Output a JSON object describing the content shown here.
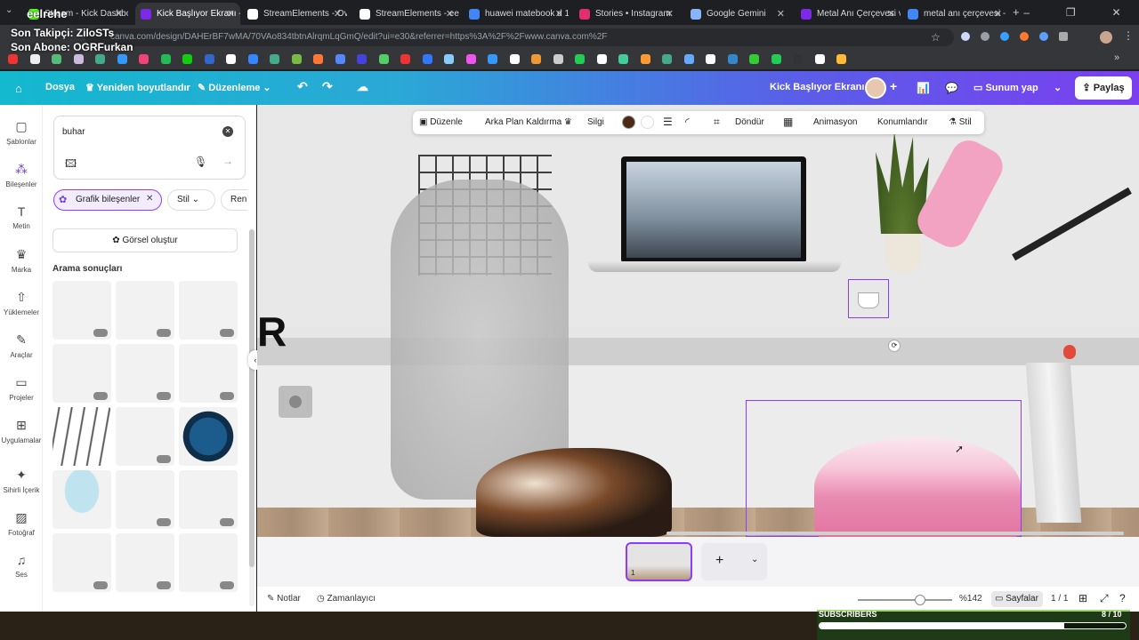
{
  "overlay": {
    "title": "eelrehe",
    "follower": "Son Takipçi: ZiloSTs",
    "subscriber": "Son Abone: OGRFurkan"
  },
  "tabs": [
    {
      "label": "Stream - Kick Dashbo",
      "color": "#53fc18"
    },
    {
      "label": "Kick Başlıyor Ekranı -",
      "color": "#7d2ae8"
    },
    {
      "label": "StreamElements - Ov",
      "color": "#fff"
    },
    {
      "label": "StreamElements - ee",
      "color": "#fff"
    },
    {
      "label": "huawei matebook d 1",
      "color": "#4285f4"
    },
    {
      "label": "Stories • Instagram",
      "color": "#e1306c"
    },
    {
      "label": "Google Gemini",
      "color": "#8ab4f8"
    },
    {
      "label": "Metal Anı Çerçevesi v",
      "color": "#7d2ae8"
    },
    {
      "label": "metal anı çerçevesi -",
      "color": "#4285f4"
    }
  ],
  "url": "canva.com/design/DAHErBF7wMA/70VAo834tbtnAlrqmLqGmQ/edit?ui=e30&referrer=https%3A%2F%2Fwww.canva.com%2F",
  "header": {
    "file": "Dosya",
    "resize": "Yeniden boyutlandır",
    "edit": "Düzenleme",
    "design_title": "Kick Başlıyor Ekranı",
    "present": "Sunum yap",
    "share": "Paylaş"
  },
  "rail": [
    "Şablonlar",
    "Bileşenler",
    "Metin",
    "Marka",
    "Yüklemeler",
    "Araçlar",
    "Projeler",
    "Uygulamalar",
    "Sihirli İçerik",
    "Fotoğraf",
    "Ses"
  ],
  "panel": {
    "search_value": "buhar",
    "chip": "Grafik bileşenler",
    "style": "Stil",
    "color": "Renk",
    "generate": "Görsel oluştur",
    "results": "Arama sonuçları"
  },
  "toolbar": {
    "edit": "Düzenle",
    "bg_remove": "Arka Plan Kaldırma",
    "erase": "Silgi",
    "rotate": "Döndür",
    "animate": "Animasyon",
    "position": "Konumlandır",
    "style": "Stil",
    "swatch": "#4a2a14"
  },
  "footer": {
    "notes": "Notlar",
    "timer": "Zamanlayıcı",
    "zoom": "%142",
    "pages": "Sayfalar",
    "page_count": "1 / 1",
    "page_num": "1"
  },
  "stream": {
    "subs_label": "SUBSCRIBERS",
    "subs_count": "8 / 10",
    "subs_progress": 0.8
  }
}
